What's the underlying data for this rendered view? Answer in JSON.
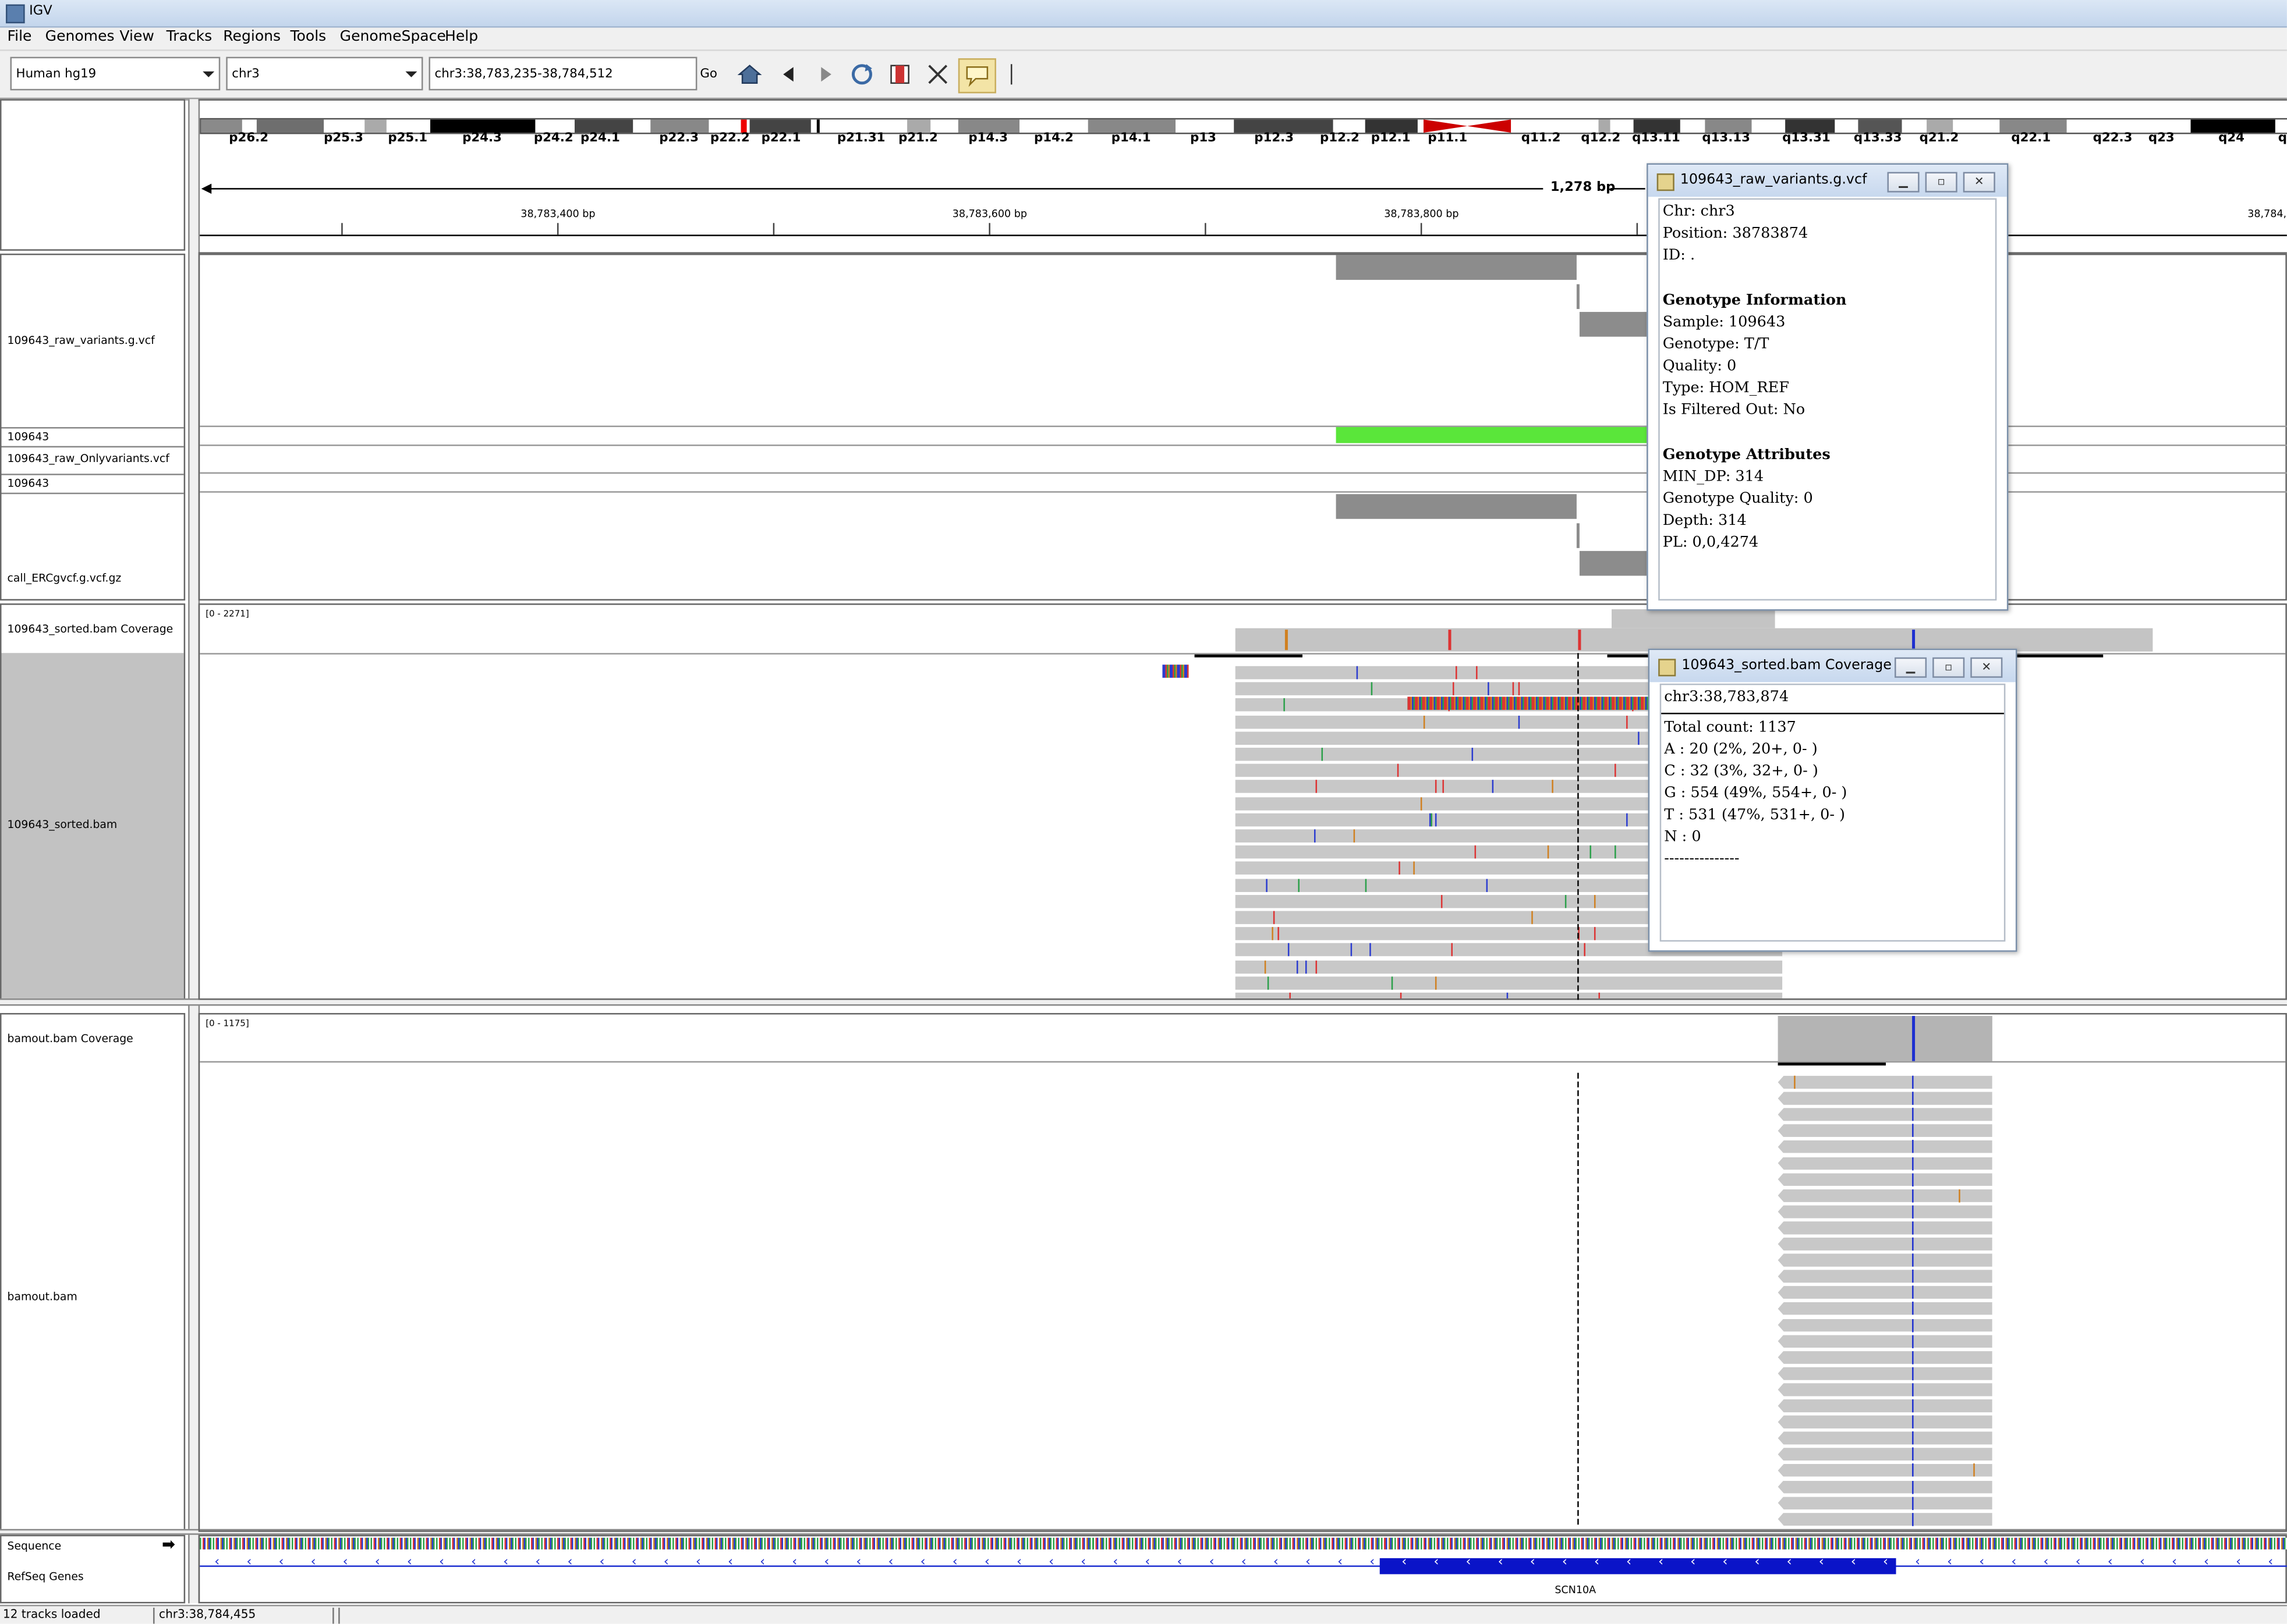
{
  "app": {
    "title": "IGV"
  },
  "menu": [
    "File",
    "Genomes",
    "View",
    "Tracks",
    "Regions",
    "Tools",
    "GenomeSpace",
    "Help"
  ],
  "toolbar": {
    "genome": "Human hg19",
    "chromosome": "chr3",
    "locus": "chr3:38,783,235-38,784,512",
    "go": "Go"
  },
  "icons": [
    "home-icon",
    "back-icon",
    "forward-icon",
    "refresh-icon",
    "roi-icon",
    "fit-icon",
    "popup-icon"
  ],
  "ideogram_bands": [
    "p26.2",
    "p25.3",
    "p25.1",
    "p24.3",
    "p24.2",
    "p24.1",
    "p22.3",
    "p22.2",
    "p22.1",
    "p21.31",
    "p21.2",
    "p14.3",
    "p14.2",
    "p14.1",
    "p13",
    "p12.3",
    "p12.2",
    "p12.1",
    "p11.1",
    "q11.2",
    "q12.2",
    "q13.11",
    "q13.13",
    "q13.31",
    "q13.33",
    "q21.2",
    "q22.1",
    "q22.3",
    "q23",
    "q24",
    "q"
  ],
  "ruler": {
    "span": "1,278 bp",
    "ticks": [
      "38,783,400 bp",
      "38,783,600 bp",
      "38,783,800 bp",
      "38,784,"
    ]
  },
  "tracks": {
    "vcf1": "109643_raw_variants.g.vcf",
    "sample1": "109643",
    "vcf2": "109643_raw_Onlyvariants.vcf",
    "sample2": "109643",
    "vcf3": "call_ERCgvcf.g.vcf.gz",
    "cov1": "109643_sorted.bam Coverage",
    "cov1_range": "[0 - 2271]",
    "bam1": "109643_sorted.bam",
    "cov2": "bamout.bam Coverage",
    "cov2_range": "[0 - 1175]",
    "bam2": "bamout.bam",
    "sequence": "Sequence",
    "refseq": "RefSeq Genes",
    "gene": "SCN10A"
  },
  "popup_vcf": {
    "title": "109643_raw_variants.g.vcf",
    "lines": [
      "Chr: chr3",
      "Position: 38783874",
      "ID: ."
    ],
    "geno_header": "Genotype Information",
    "geno_lines": [
      "Sample: 109643",
      "Genotype: T/T",
      "Quality: 0",
      "Type: HOM_REF",
      "Is Filtered Out: No"
    ],
    "attr_header": "Genotype Attributes",
    "attr_lines": [
      "MIN_DP: 314",
      "Genotype Quality: 0",
      "Depth: 314",
      "PL: 0,0,4274"
    ]
  },
  "popup_cov": {
    "title": "109643_sorted.bam Coverage",
    "position": "chr3:38,783,874",
    "lines": [
      "Total count: 1137",
      "A : 20 (2%, 20+, 0- )",
      "C : 32 (3%, 32+, 0- )",
      "G : 554 (49%, 554+, 0- )",
      "T : 531 (47%, 531+, 0- )",
      "N : 0",
      "---------------"
    ]
  },
  "status": {
    "tracks": "12 tracks loaded",
    "locus": "chr3:38,784,455"
  },
  "colors": {
    "variant_grey": "#8c8c8c",
    "hom_ref": "#5ae63a",
    "read": "#c8c8c8",
    "gene_blue": "#0a14c8"
  }
}
